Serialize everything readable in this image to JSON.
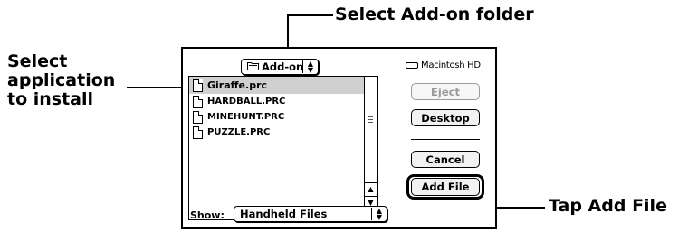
{
  "callouts": {
    "select_folder": "Select Add-on folder",
    "select_app_line1": "Select",
    "select_app_line2": "application",
    "select_app_line3": "to install",
    "tap_add_file": "Tap Add File"
  },
  "dialog": {
    "folder_popup": "Add-on",
    "drive_name": "Macintosh HD",
    "files": [
      {
        "name": "Giraffe.prc",
        "selected": true
      },
      {
        "name": "HARDBALL.PRC",
        "selected": false
      },
      {
        "name": "MINEHUNT.PRC",
        "selected": false
      },
      {
        "name": "PUZZLE.PRC",
        "selected": false
      }
    ],
    "buttons": {
      "eject": "Eject",
      "desktop": "Desktop",
      "cancel": "Cancel",
      "add_file": "Add File"
    },
    "show_label": "Show:",
    "show_value": "Handheld Files"
  },
  "icons": {
    "folder": "folder-icon",
    "drive": "hard-drive-icon",
    "document": "document-icon",
    "popup_arrows": "up-down-arrows-icon",
    "scroll_up": "scroll-up-arrow-icon",
    "scroll_down": "scroll-down-arrow-icon"
  },
  "colors": {
    "selection": "#d0d0d0",
    "disabled_text": "#9a9a9a"
  }
}
